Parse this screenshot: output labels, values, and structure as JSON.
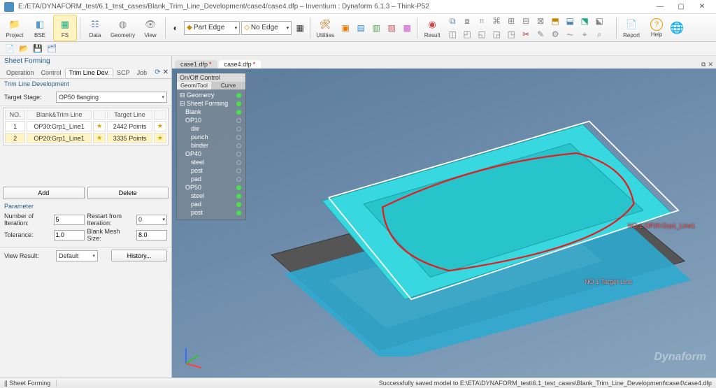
{
  "window": {
    "title": "E:/ETA/DYNAFORM_test/6.1_test_cases/Blank_Trim_Line_Development/case4/case4.dfp – Inventium : Dynaform 6.1.3  – Think-P52"
  },
  "ribbon": {
    "project": "Project",
    "bse": "BSE",
    "fs": "FS",
    "data": "Data",
    "geometry": "Geometry",
    "view": "View",
    "part_edge_combo": "Part Edge",
    "no_edge_combo": "No Edge",
    "utilities": "Utilities",
    "result": "Result",
    "report": "Report",
    "help": "Help"
  },
  "tabs": {
    "t1": "case1.dfp",
    "t2": "case4.dfp",
    "dirty": "*"
  },
  "left": {
    "title": "Sheet Forming",
    "op_tabs": {
      "operation": "Operation",
      "control": "Control",
      "trim": "Trim Line Dev.",
      "scp": "SCP",
      "job": "Job"
    },
    "section1": "Trim Line Development",
    "target_stage_label": "Target Stage:",
    "target_stage_value": "OP50 flanging",
    "table": {
      "h_no": "NO.",
      "h_blank": "Blank&Trim Line",
      "h_target": "Target Line",
      "r1_no": "1",
      "r1_blank": "OP30:Grp1_Line1",
      "r1_target": "2442 Points",
      "r2_no": "2",
      "r2_blank": "OP20:Grp1_Line1",
      "r2_target": "3335 Points"
    },
    "btn_add": "Add",
    "btn_delete": "Delete",
    "param_title": "Parameter",
    "p_iter_lbl": "Number of Iteration:",
    "p_iter_val": "5",
    "p_restart_lbl": "Restart from Iteration:",
    "p_restart_val": "0",
    "p_tol_lbl": "Tolerance:",
    "p_tol_val": "1.0",
    "p_mesh_lbl": "Blank Mesh Size:",
    "p_mesh_val": "8.0",
    "view_result_lbl": "View Result:",
    "view_result_val": "Default",
    "btn_history": "History..."
  },
  "tree": {
    "hdr": "On/Off Control",
    "tab_geom": "Geom/Tool",
    "tab_curve": "Curve",
    "nodes": [
      {
        "label": "Geometry",
        "indent": 0,
        "on": true
      },
      {
        "label": "Sheet Forming",
        "indent": 0,
        "on": true
      },
      {
        "label": "Blank",
        "indent": 1,
        "on": true
      },
      {
        "label": "OP10",
        "indent": 1,
        "on": false
      },
      {
        "label": "die",
        "indent": 2,
        "on": false
      },
      {
        "label": "punch",
        "indent": 2,
        "on": false
      },
      {
        "label": "binder",
        "indent": 2,
        "on": false
      },
      {
        "label": "OP40",
        "indent": 1,
        "on": false
      },
      {
        "label": "steel",
        "indent": 2,
        "on": false
      },
      {
        "label": "post",
        "indent": 2,
        "on": false
      },
      {
        "label": "pad",
        "indent": 2,
        "on": false
      },
      {
        "label": "OP50",
        "indent": 1,
        "on": true
      },
      {
        "label": "steel",
        "indent": 2,
        "on": true
      },
      {
        "label": "pad",
        "indent": 2,
        "on": true
      },
      {
        "label": "post",
        "indent": 2,
        "on": true
      }
    ]
  },
  "viewport": {
    "annot1": "NO.1 OP30:Grp1_Line1",
    "annot2": "NO.1 Target Line",
    "brand": "Dynaform"
  },
  "status": {
    "left": "|| Sheet Forming",
    "right": "Successfully saved model to E:\\ETA\\DYNAFORM_test\\6.1_test_cases\\Blank_Trim_Line_Development\\case4\\case4.dfp"
  }
}
